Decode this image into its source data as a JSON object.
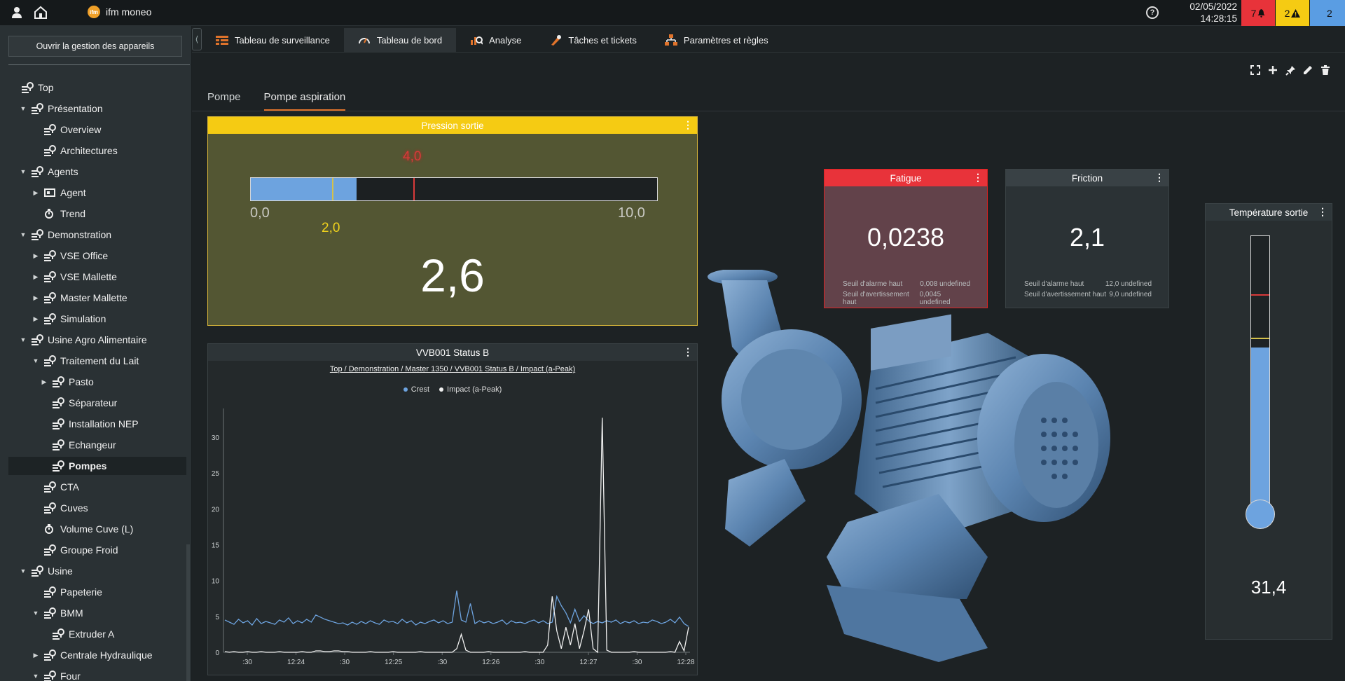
{
  "app": {
    "name": "ifm moneo",
    "logo_text": "ifm"
  },
  "header": {
    "date": "02/05/2022",
    "time": "14:28:15",
    "alarm_count": "7",
    "warning_count": "2",
    "info_count": "2",
    "colors": {
      "alarm": "#e8333a",
      "warning": "#f5cb13",
      "info": "#5a9de3"
    }
  },
  "sidebar": {
    "device_button": "Ouvrir la gestion des appareils",
    "tree": [
      {
        "label": "Top",
        "level": 0,
        "arrow": "",
        "icon": "node"
      },
      {
        "label": "Présentation",
        "level": 1,
        "arrow": "▼",
        "icon": "node"
      },
      {
        "label": "Overview",
        "level": 2,
        "arrow": "",
        "icon": "node"
      },
      {
        "label": "Architectures",
        "level": 2,
        "arrow": "",
        "icon": "node"
      },
      {
        "label": "Agents",
        "level": 1,
        "arrow": "▼",
        "icon": "node"
      },
      {
        "label": "Agent",
        "level": 2,
        "arrow": "▶",
        "icon": "agent"
      },
      {
        "label": "Trend",
        "level": 2,
        "arrow": "",
        "icon": "trend"
      },
      {
        "label": "Demonstration",
        "level": 1,
        "arrow": "▼",
        "icon": "node"
      },
      {
        "label": "VSE Office",
        "level": 2,
        "arrow": "▶",
        "icon": "node"
      },
      {
        "label": "VSE Mallette",
        "level": 2,
        "arrow": "▶",
        "icon": "node"
      },
      {
        "label": "Master Mallette",
        "level": 2,
        "arrow": "▶",
        "icon": "node"
      },
      {
        "label": "Simulation",
        "level": 2,
        "arrow": "▶",
        "icon": "node"
      },
      {
        "label": "Usine Agro Alimentaire",
        "level": 1,
        "arrow": "▼",
        "icon": "node"
      },
      {
        "label": "Traitement du Lait",
        "level": 2,
        "arrow": "▼",
        "icon": "node"
      },
      {
        "label": "Pasto",
        "level": 3,
        "arrow": "▶",
        "icon": "node"
      },
      {
        "label": "Séparateur",
        "level": 3,
        "arrow": "",
        "icon": "node"
      },
      {
        "label": "Installation NEP",
        "level": 3,
        "arrow": "",
        "icon": "node"
      },
      {
        "label": "Echangeur",
        "level": 3,
        "arrow": "",
        "icon": "node"
      },
      {
        "label": "Pompes",
        "level": 3,
        "arrow": "",
        "icon": "node",
        "selected": true
      },
      {
        "label": "CTA",
        "level": 2,
        "arrow": "",
        "icon": "node"
      },
      {
        "label": "Cuves",
        "level": 2,
        "arrow": "",
        "icon": "node"
      },
      {
        "label": "Volume Cuve (L)",
        "level": 2,
        "arrow": "",
        "icon": "trend"
      },
      {
        "label": "Groupe Froid",
        "level": 2,
        "arrow": "",
        "icon": "node"
      },
      {
        "label": "Usine",
        "level": 1,
        "arrow": "▼",
        "icon": "node"
      },
      {
        "label": "Papeterie",
        "level": 2,
        "arrow": "",
        "icon": "node"
      },
      {
        "label": "BMM",
        "level": 2,
        "arrow": "▼",
        "icon": "node"
      },
      {
        "label": "Extruder A",
        "level": 3,
        "arrow": "",
        "icon": "node"
      },
      {
        "label": "Centrale Hydraulique",
        "level": 2,
        "arrow": "▶",
        "icon": "node"
      },
      {
        "label": "Four",
        "level": 2,
        "arrow": "▼",
        "icon": "node"
      }
    ]
  },
  "tabs": [
    {
      "label": "Tableau de surveillance",
      "icon": "grid-icon",
      "active": false
    },
    {
      "label": "Tableau de bord",
      "icon": "gauge-icon",
      "active": true
    },
    {
      "label": "Analyse",
      "icon": "analysis-icon",
      "active": false
    },
    {
      "label": "Tâches et tickets",
      "icon": "tools-icon",
      "active": false
    },
    {
      "label": "Paramètres et règles",
      "icon": "hierarchy-icon",
      "active": false
    }
  ],
  "subtabs": [
    {
      "label": "Pompe",
      "active": false
    },
    {
      "label": "Pompe aspiration",
      "active": true
    }
  ],
  "toolbar": [
    "fullscreen-icon",
    "plus-icon",
    "pin-icon",
    "pencil-icon",
    "trash-icon"
  ],
  "pressure_widget": {
    "title": "Pression sortie",
    "value": "2,6",
    "value_num": 2.6,
    "min": "0,0",
    "max": "10,0",
    "min_num": 0,
    "max_num": 10,
    "warning": "2,0",
    "warning_num": 2.0,
    "alarm": "4,0",
    "alarm_num": 4.0
  },
  "chart_widget": {
    "title": "VVB001 Status B",
    "path": "Top / Demonstration / Master 1350 / VVB001 Status B / Impact (a-Peak)"
  },
  "chart_data": {
    "type": "line",
    "x": [
      ":30",
      "12:24",
      ":30",
      "12:25",
      ":30",
      "12:26",
      ":30",
      "12:27",
      ":30",
      "12:28"
    ],
    "series": [
      {
        "name": "Crest",
        "color": "#6da3df",
        "values": [
          4.5,
          4.2,
          3.9,
          4.6,
          4.1,
          4.4,
          3.8,
          4.7,
          4.0,
          4.3,
          4.1,
          3.9,
          4.5,
          4.2,
          4.8,
          4.0,
          4.4,
          4.1,
          4.6,
          4.2,
          5.2,
          4.9,
          4.6,
          4.4,
          4.2,
          4.0,
          4.1,
          3.8,
          4.2,
          3.9,
          4.3,
          4.0,
          4.4,
          4.1,
          3.9,
          4.5,
          4.2,
          4.3,
          4.0,
          4.6,
          4.1,
          4.4,
          3.8,
          4.2,
          4.0,
          4.3,
          4.5,
          4.1,
          4.4,
          4.0,
          4.2,
          8.6,
          4.5,
          4.2,
          6.8,
          4.0,
          4.4,
          4.1,
          4.3,
          4.0,
          4.2,
          4.5,
          3.9,
          4.4,
          4.1,
          4.2,
          4.0,
          4.3,
          4.5,
          4.1,
          4.4,
          4.0,
          4.2,
          7.8,
          6.5,
          5.5,
          4.1,
          6.0,
          4.3,
          5.1,
          4.4,
          4.0,
          4.3,
          4.1,
          4.4,
          4.2,
          4.5,
          4.0,
          4.3,
          4.1,
          4.4,
          4.0,
          4.2,
          4.1,
          4.5,
          4.3,
          4.0,
          4.2,
          4.6,
          4.1,
          4.9,
          4.0,
          3.6
        ]
      },
      {
        "name": "Impact (a-Peak)",
        "color": "#f0f0f0",
        "values": [
          0.1,
          0.0,
          0.1,
          0.0,
          0.0,
          0.1,
          0.0,
          0.0,
          0.1,
          0.0,
          0.0,
          0.0,
          0.1,
          0.0,
          0.0,
          0.0,
          0.0,
          0.1,
          0.0,
          0.0,
          0.2,
          0.2,
          0.1,
          0.1,
          0.2,
          0.2,
          0.1,
          0.1,
          0.0,
          0.0,
          0.0,
          0.0,
          0.1,
          0.0,
          0.0,
          0.0,
          0.0,
          0.1,
          0.0,
          0.0,
          0.0,
          0.0,
          0.0,
          0.1,
          0.0,
          0.0,
          0.0,
          0.0,
          0.0,
          0.0,
          0.0,
          0.5,
          2.5,
          0.3,
          0.0,
          0.0,
          0.0,
          0.0,
          0.1,
          0.0,
          0.0,
          0.0,
          0.0,
          0.0,
          0.0,
          0.0,
          0.1,
          0.0,
          0.0,
          0.0,
          0.0,
          1.0,
          7.8,
          3.0,
          0.5,
          3.5,
          1.0,
          4.0,
          0.5,
          3.0,
          6.0,
          0.5,
          0.0,
          32.7,
          0.3,
          0.0,
          0.0,
          0.0,
          0.0,
          0.0,
          0.1,
          0.0,
          0.0,
          0.0,
          0.0,
          0.0,
          0.0,
          0.0,
          0.1,
          0.0,
          1.5,
          0.2,
          3.5
        ]
      }
    ],
    "ylim": [
      0,
      34
    ],
    "yticks": [
      0,
      5,
      10,
      15,
      20,
      25,
      30
    ],
    "grid": false,
    "legend": "top-center"
  },
  "fatigue_widget": {
    "title": "Fatigue",
    "value": "0,0238",
    "alarm_label": "Seuil d'alarme haut",
    "alarm_value": "0,008 undefined",
    "warn_label": "Seuil d'avertissement haut",
    "warn_value": "0,0045 undefined"
  },
  "friction_widget": {
    "title": "Friction",
    "value": "2,1",
    "alarm_label": "Seuil d'alarme haut",
    "alarm_value": "12,0 undefined",
    "warn_label": "Seuil d'avertissement haut",
    "warn_value": "9,0 undefined"
  },
  "temperature_widget": {
    "title": "Température sortie",
    "value": "31,4",
    "fill_fraction": 0.59,
    "alarm_fraction": 0.78,
    "warn_fraction": 0.62
  }
}
